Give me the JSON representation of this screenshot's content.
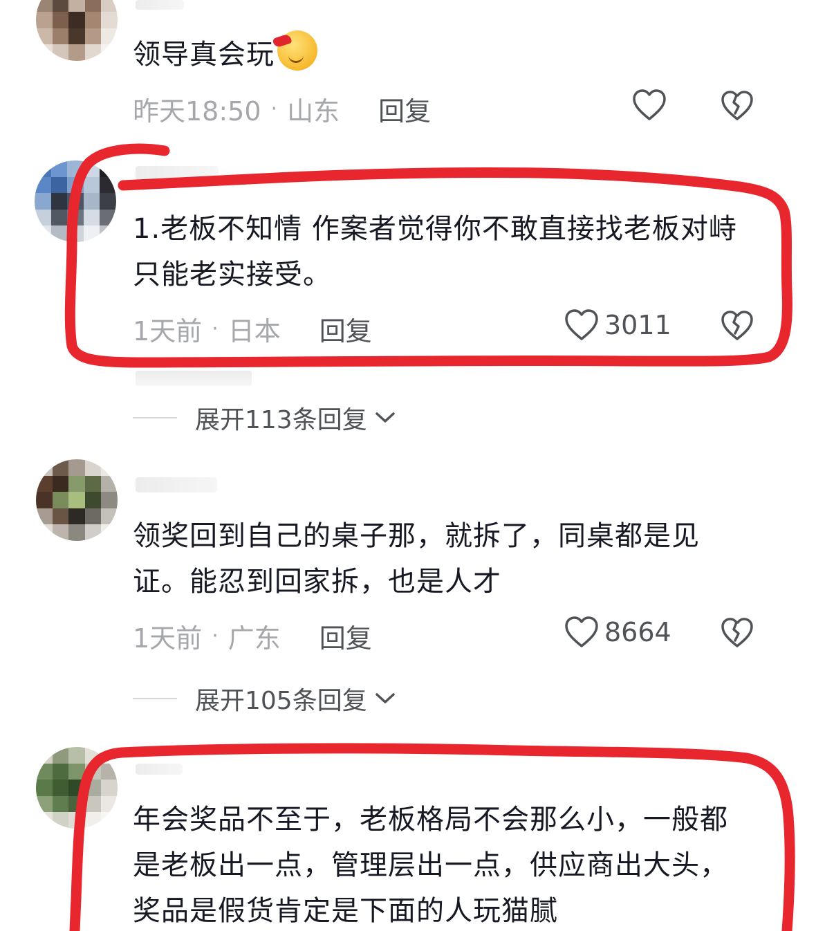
{
  "comments": [
    {
      "text": "领导真会玩",
      "emoji": "smirk-santa-emoji",
      "time": "昨天18:50",
      "location": "山东",
      "reply_label": "回复",
      "like_count": ""
    },
    {
      "text": "1.老板不知情 作案者觉得你不敢直接找老板对峙 只能老实接受。",
      "time": "1天前",
      "location": "日本",
      "reply_label": "回复",
      "like_count": "3011",
      "expand_label": "展开113条回复"
    },
    {
      "text": "领奖回到自己的桌子那，就拆了，同桌都是见证。能忍到回家拆，也是人才",
      "time": "1天前",
      "location": "广东",
      "reply_label": "回复",
      "like_count": "8664",
      "expand_label": "展开105条回复"
    },
    {
      "text": "年会奖品不至于，老板格局不会那么小，一般都是老板出一点，管理层出一点，供应商出大头，奖品是假货肯定是下面的人玩猫腻"
    }
  ],
  "meta_separator": "·",
  "colors": {
    "highlight_stroke": "#e8262d",
    "meta_text": "#a5a7ab",
    "reply_text": "#4f5257"
  }
}
